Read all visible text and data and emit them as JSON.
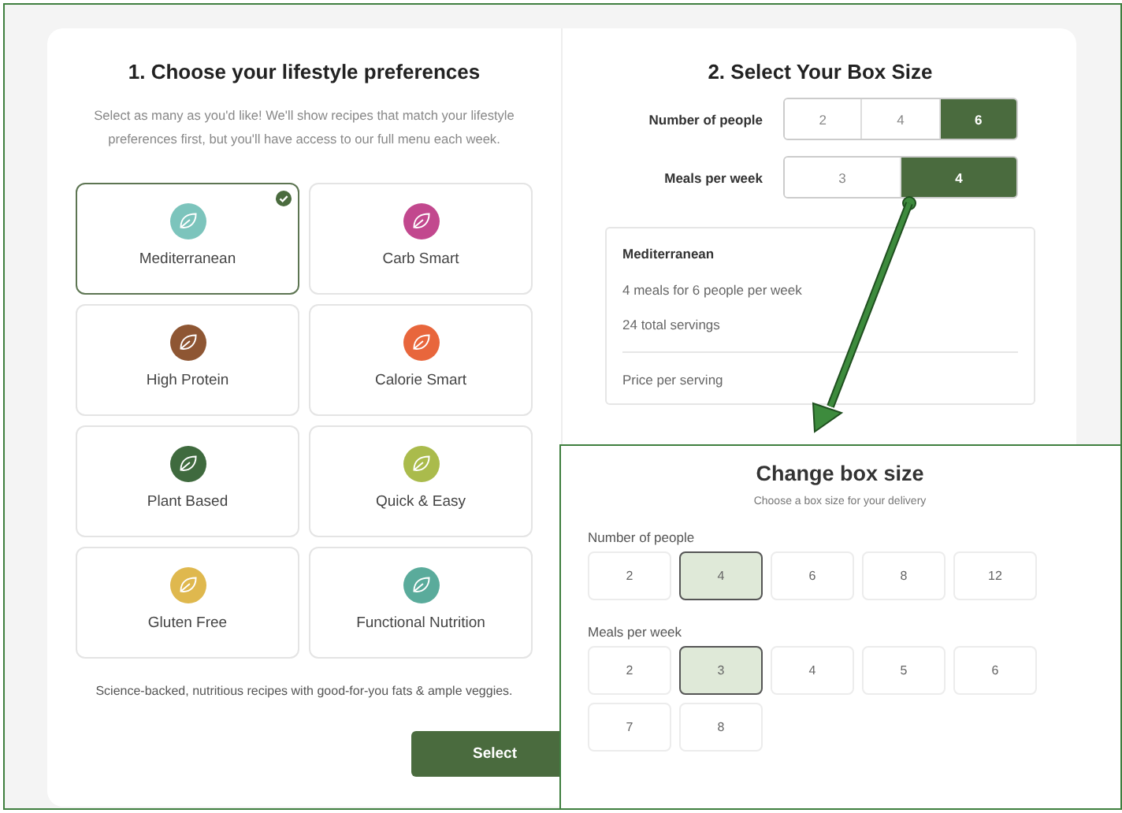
{
  "preferences": {
    "title": "1. Choose your lifestyle preferences",
    "description": "Select as many as you'd like! We'll show recipes that match your lifestyle preferences first, but you'll have access to our full menu each week.",
    "options": [
      {
        "label": "Mediterranean",
        "color": "#7cc4bc",
        "selected": true
      },
      {
        "label": "Carb Smart",
        "color": "#c2488e",
        "selected": false
      },
      {
        "label": "High Protein",
        "color": "#8e5633",
        "selected": false
      },
      {
        "label": "Calorie Smart",
        "color": "#e8663c",
        "selected": false
      },
      {
        "label": "Plant Based",
        "color": "#3f6a3e",
        "selected": false
      },
      {
        "label": "Quick & Easy",
        "color": "#aabb4c",
        "selected": false
      },
      {
        "label": "Gluten Free",
        "color": "#dfb84e",
        "selected": false
      },
      {
        "label": "Functional Nutrition",
        "color": "#5aab9b",
        "selected": false
      }
    ],
    "note": "Science-backed, nutritious recipes with good-for-you fats & ample veggies.",
    "button": "Select"
  },
  "box_size": {
    "title": "2. Select Your Box Size",
    "rows": [
      {
        "label": "Number of people",
        "options": [
          {
            "label": "2",
            "selected": false
          },
          {
            "label": "4",
            "selected": false
          },
          {
            "label": "6",
            "selected": true
          }
        ]
      },
      {
        "label": "Meals per week",
        "options": [
          {
            "label": "3",
            "selected": false
          },
          {
            "label": "4",
            "selected": true
          }
        ]
      }
    ],
    "summary": {
      "plan": "Mediterranean",
      "lines": [
        "4 meals for 6 people per week",
        "24 total servings"
      ],
      "price_label": "Price per serving"
    }
  },
  "change_box_size": {
    "title": "Change box size",
    "subtitle": "Choose a box size for your delivery",
    "groups": [
      {
        "label": "Number of people",
        "options": [
          {
            "label": "2",
            "selected": false
          },
          {
            "label": "4",
            "selected": true
          },
          {
            "label": "6",
            "selected": false
          },
          {
            "label": "8",
            "selected": false
          },
          {
            "label": "12",
            "selected": false
          }
        ]
      },
      {
        "label": "Meals per week",
        "options": [
          {
            "label": "2",
            "selected": false
          },
          {
            "label": "3",
            "selected": true
          },
          {
            "label": "4",
            "selected": false
          },
          {
            "label": "5",
            "selected": false
          },
          {
            "label": "6",
            "selected": false
          },
          {
            "label": "7",
            "selected": false
          },
          {
            "label": "8",
            "selected": false
          }
        ]
      }
    ]
  }
}
